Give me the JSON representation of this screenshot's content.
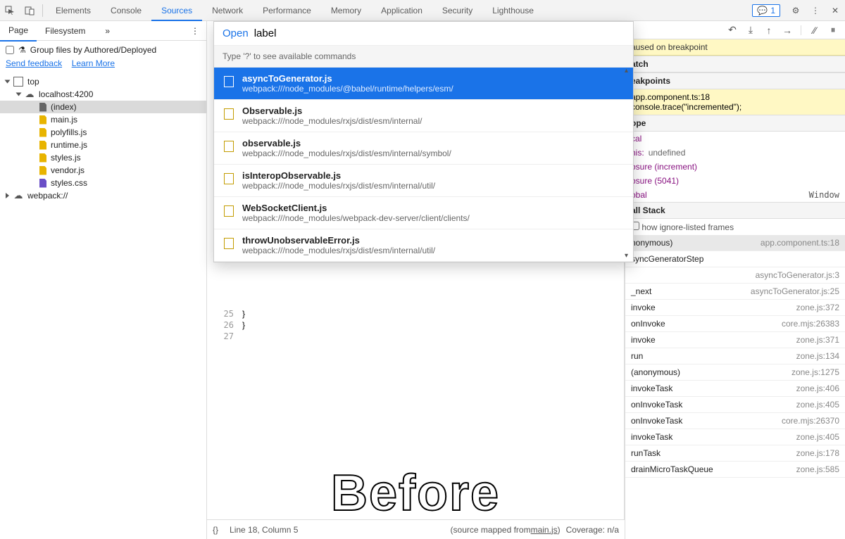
{
  "topbar": {
    "tabs": [
      "Elements",
      "Console",
      "Sources",
      "Network",
      "Performance",
      "Memory",
      "Application",
      "Security",
      "Lighthouse"
    ],
    "active_tab": 2,
    "feedback_count": "1"
  },
  "left": {
    "tabs": {
      "page": "Page",
      "filesystem": "Filesystem"
    },
    "group_label": "Group files by Authored/Deployed",
    "send_feedback": "Send feedback",
    "learn_more": "Learn More",
    "tree": [
      {
        "label": "top",
        "kind": "frame",
        "depth": 0,
        "open": true
      },
      {
        "label": "localhost:4200",
        "kind": "cloud",
        "depth": 1,
        "open": true
      },
      {
        "label": "(index)",
        "kind": "file",
        "depth": 2,
        "selected": true
      },
      {
        "label": "main.js",
        "kind": "js",
        "depth": 2
      },
      {
        "label": "polyfills.js",
        "kind": "js",
        "depth": 2
      },
      {
        "label": "runtime.js",
        "kind": "js",
        "depth": 2
      },
      {
        "label": "styles.js",
        "kind": "js",
        "depth": 2
      },
      {
        "label": "vendor.js",
        "kind": "js",
        "depth": 2
      },
      {
        "label": "styles.css",
        "kind": "css",
        "depth": 2
      },
      {
        "label": "webpack://",
        "kind": "cloud",
        "depth": 0,
        "open": false
      }
    ]
  },
  "dropdown": {
    "open_label": "Open",
    "query": "label",
    "hint": "Type '?' to see available commands",
    "results": [
      {
        "file": "asyncToGenerator.js",
        "path": "webpack:///node_modules/@babel/runtime/helpers/esm/",
        "selected": true
      },
      {
        "file": "Observable.js",
        "path": "webpack:///node_modules/rxjs/dist/esm/internal/"
      },
      {
        "file": "observable.js",
        "path": "webpack:///node_modules/rxjs/dist/esm/internal/symbol/"
      },
      {
        "file": "isInteropObservable.js",
        "path": "webpack:///node_modules/rxjs/dist/esm/internal/util/"
      },
      {
        "file": "WebSocketClient.js",
        "path": "webpack:///node_modules/webpack-dev-server/client/clients/"
      },
      {
        "file": "throwUnobservableError.js",
        "path": "webpack:///node_modules/rxjs/dist/esm/internal/util/"
      }
    ]
  },
  "gutter": [
    "25",
    "26",
    "27"
  ],
  "code": [
    "  }",
    "}",
    ""
  ],
  "before_label": "Before",
  "statusbar": {
    "braces": "{}",
    "pos": "Line 18, Column 5",
    "mapped": "(source mapped from ",
    "mapped_file": "main.js",
    "mapped_end": ")",
    "coverage": "Coverage: n/a"
  },
  "right": {
    "paused": "aused on breakpoint",
    "watch": "atch",
    "breakpoints": "eakpoints",
    "bp": {
      "file": "app.component.ts:18",
      "code": "console.trace(\"incremented\");"
    },
    "scope_head": "ope",
    "scope": [
      {
        "k": "cal",
        "v": ""
      },
      {
        "k": "his:",
        "v": "undefined"
      },
      {
        "k": "osure (increment)",
        "v": ""
      },
      {
        "k": "osure (5041)",
        "v": ""
      },
      {
        "k": "obal",
        "v": "",
        "r": "Window"
      }
    ],
    "callstack_head": "all Stack",
    "ignore": "how ignore-listed frames",
    "stack": [
      {
        "fn": "nonymous)",
        "loc": "app.component.ts:18",
        "sel": true
      },
      {
        "fn": "syncGeneratorStep",
        "loc": ""
      },
      {
        "fn": "",
        "loc": "asyncToGenerator.js:3"
      },
      {
        "fn": "_next",
        "loc": "asyncToGenerator.js:25"
      },
      {
        "fn": "invoke",
        "loc": "zone.js:372"
      },
      {
        "fn": "onInvoke",
        "loc": "core.mjs:26383"
      },
      {
        "fn": "invoke",
        "loc": "zone.js:371"
      },
      {
        "fn": "run",
        "loc": "zone.js:134"
      },
      {
        "fn": "(anonymous)",
        "loc": "zone.js:1275"
      },
      {
        "fn": "invokeTask",
        "loc": "zone.js:406"
      },
      {
        "fn": "onInvokeTask",
        "loc": "zone.js:405"
      },
      {
        "fn": "onInvokeTask",
        "loc": "core.mjs:26370"
      },
      {
        "fn": "invokeTask",
        "loc": "zone.js:405"
      },
      {
        "fn": "runTask",
        "loc": "zone.js:178"
      },
      {
        "fn": "drainMicroTaskQueue",
        "loc": "zone.js:585"
      }
    ]
  }
}
